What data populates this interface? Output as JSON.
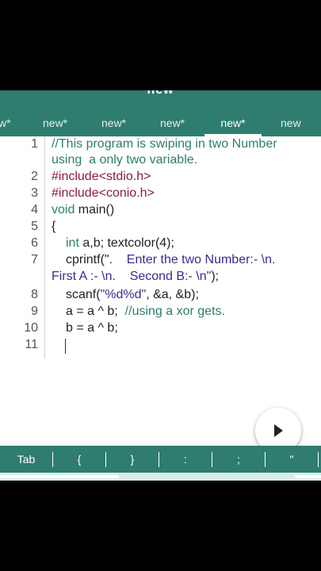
{
  "tabs": [
    {
      "label": "w*"
    },
    {
      "label": "new*"
    },
    {
      "label": "new*"
    },
    {
      "label": "new*"
    },
    {
      "label": "new*",
      "active": true
    },
    {
      "label": "new"
    }
  ],
  "editor": {
    "line_numbers": [
      "1",
      "2",
      "3",
      "4",
      "5",
      "6",
      "7",
      "8",
      "9",
      "10",
      "11"
    ],
    "code": {
      "l1a": "//This program is swiping in two Number",
      "l1b": "using  a only two variable.",
      "l2": "#include<stdio.h>",
      "l3": "#include<conio.h>",
      "l4_kw": "void",
      "l4_rest": " main()",
      "l5": "{",
      "l6_kw": "int",
      "l6_rest": " a,b; textcolor(4);",
      "l7_a": "cprintf(\"",
      "l7_b": ".    Enter the two Number:- \\n.",
      "l7_c": "First A :- \\n.    Second B:- \\n\"",
      "l7_d": ");",
      "l8_a": "scanf(",
      "l8_b": "\"%d%d\"",
      "l8_c": ", &a, &b);",
      "l9_a": "a = a ^ b;  ",
      "l9_b": "//using a xor gets.",
      "l10": "b = a ^ b;"
    }
  },
  "run_button": {
    "icon": "play-icon"
  },
  "keybar": [
    "Tab",
    "{",
    "}",
    ":",
    ";",
    "\""
  ],
  "colors": {
    "accent": "#2e7d6f",
    "comment": "#2e7d6f",
    "preprocessor": "#8a1b4a",
    "string": "#3b2b8f"
  }
}
